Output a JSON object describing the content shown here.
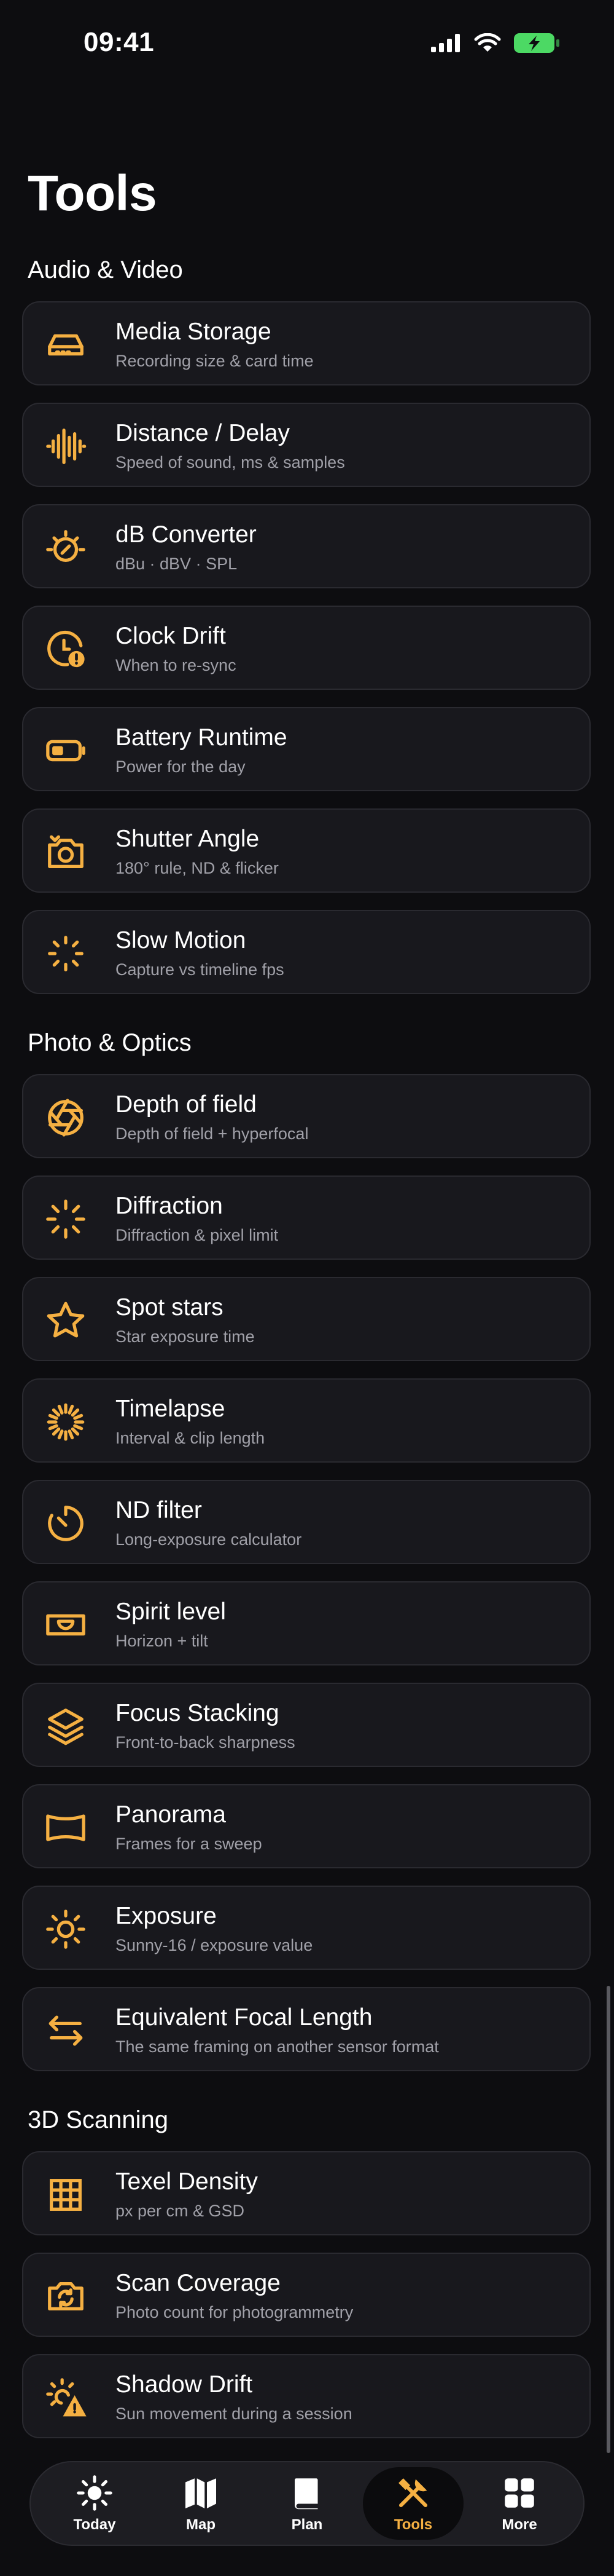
{
  "status_bar": {
    "time": "09:41"
  },
  "colors": {
    "accent": "#f5b042",
    "background": "#0d0d10",
    "card": "#18181d",
    "battery": "#4cd964"
  },
  "page": {
    "title": "Tools"
  },
  "sections": [
    {
      "header": "Audio & Video",
      "items": [
        {
          "title": "Media Storage",
          "subtitle": "Recording size & card time",
          "icon": "storage-drive-icon"
        },
        {
          "title": "Distance / Delay",
          "subtitle": "Speed of sound, ms & samples",
          "icon": "waveform-icon"
        },
        {
          "title": "dB Converter",
          "subtitle": "dBu · dBV · SPL",
          "icon": "gauge-dial-icon"
        },
        {
          "title": "Clock Drift",
          "subtitle": "When to re-sync",
          "icon": "clock-alert-icon"
        },
        {
          "title": "Battery Runtime",
          "subtitle": "Power for the day",
          "icon": "battery-icon"
        },
        {
          "title": "Shutter Angle",
          "subtitle": "180° rule, ND & flicker",
          "icon": "camera-icon"
        },
        {
          "title": "Slow Motion",
          "subtitle": "Capture vs timeline fps",
          "icon": "slow-motion-icon"
        }
      ]
    },
    {
      "header": "Photo & Optics",
      "items": [
        {
          "title": "Depth of field",
          "subtitle": "Depth of field + hyperfocal",
          "icon": "aperture-icon"
        },
        {
          "title": "Diffraction",
          "subtitle": "Diffraction & pixel limit",
          "icon": "diffraction-rays-icon"
        },
        {
          "title": "Spot stars",
          "subtitle": "Star exposure time",
          "icon": "star-icon"
        },
        {
          "title": "Timelapse",
          "subtitle": "Interval & clip length",
          "icon": "timelapse-icon"
        },
        {
          "title": "ND filter",
          "subtitle": "Long-exposure calculator",
          "icon": "timer-icon"
        },
        {
          "title": "Spirit level",
          "subtitle": "Horizon + tilt",
          "icon": "level-icon"
        },
        {
          "title": "Focus Stacking",
          "subtitle": "Front-to-back sharpness",
          "icon": "layers-icon"
        },
        {
          "title": "Panorama",
          "subtitle": "Frames for a sweep",
          "icon": "panorama-icon"
        },
        {
          "title": "Exposure",
          "subtitle": "Sunny-16 / exposure value",
          "icon": "sun-icon"
        },
        {
          "title": "Equivalent Focal Length",
          "subtitle": "The same framing on another sensor format",
          "icon": "arrows-swap-icon"
        }
      ]
    },
    {
      "header": "3D Scanning",
      "items": [
        {
          "title": "Texel Density",
          "subtitle": "px per cm & GSD",
          "icon": "grid-icon"
        },
        {
          "title": "Scan Coverage",
          "subtitle": "Photo count for photogrammetry",
          "icon": "camera-rotate-icon"
        },
        {
          "title": "Shadow Drift",
          "subtitle": "Sun movement during a session",
          "icon": "sun-warning-icon"
        }
      ]
    }
  ],
  "tab_bar": {
    "tabs": [
      {
        "label": "Today",
        "icon": "sun-icon",
        "active": false
      },
      {
        "label": "Map",
        "icon": "map-icon",
        "active": false
      },
      {
        "label": "Plan",
        "icon": "book-icon",
        "active": false
      },
      {
        "label": "Tools",
        "icon": "tools-icon",
        "active": true
      },
      {
        "label": "More",
        "icon": "grid-squares-icon",
        "active": false
      }
    ]
  }
}
